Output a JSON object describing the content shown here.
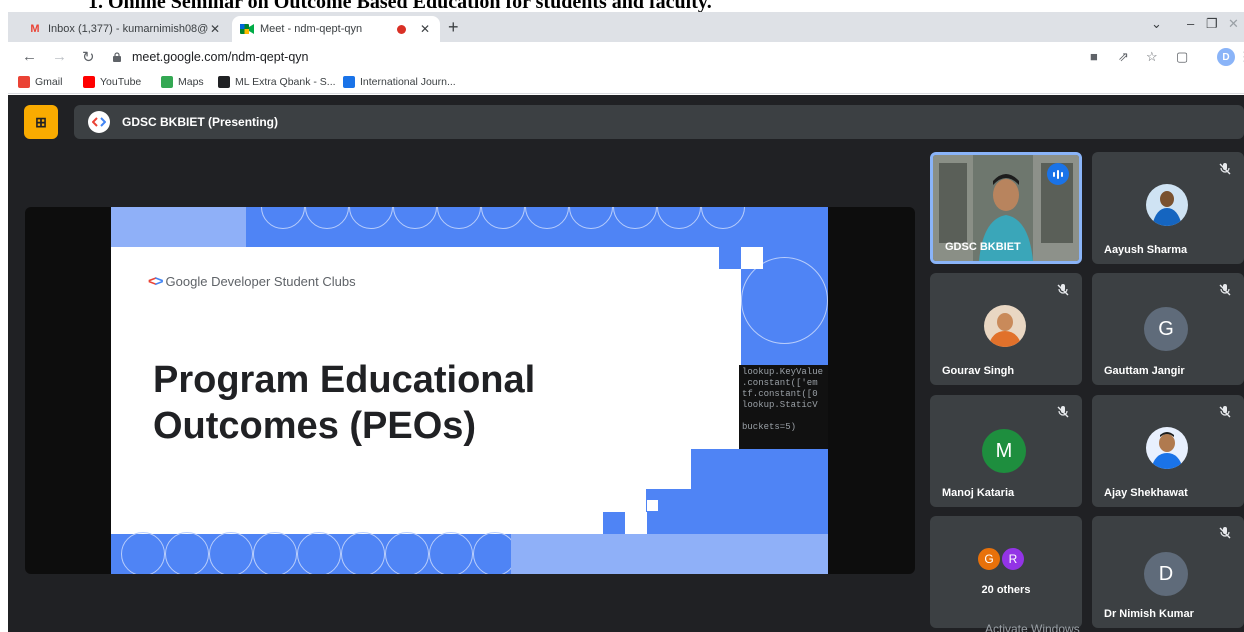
{
  "caption": "1.   Online Seminar on Outcome Based Education for students and faculty.",
  "browser": {
    "tabs": [
      {
        "title": "Inbox (1,377) - kumarnimish08@",
        "icon": "gmail-icon"
      },
      {
        "title": "Meet - ndm-qept-qyn",
        "icon": "meet-icon"
      }
    ],
    "url": "meet.google.com/ndm-qept-qyn",
    "profile_initial": "D",
    "bookmarks": [
      {
        "label": "Gmail",
        "color": "#ea4335"
      },
      {
        "label": "YouTube",
        "color": "#ff0000"
      },
      {
        "label": "Maps",
        "color": "#34a853"
      },
      {
        "label": "ML Extra Qbank - S...",
        "color": "#202124"
      },
      {
        "label": "International Journ...",
        "color": "#1a73e8"
      }
    ]
  },
  "meet": {
    "presenting_label": "GDSC BKBIET (Presenting)",
    "slide": {
      "brand": "Google Developer Student Clubs",
      "title_line1": "Program Educational",
      "title_line2": "Outcomes (PEOs)",
      "code_lines": "lookup.KeyValue\n.constant(['em\ntf.constant([0\nlookup.StaticV\n\nbuckets=5)"
    },
    "participants": [
      {
        "name": "GDSC BKBIET",
        "speaking": true
      },
      {
        "name": "Aayush Sharma",
        "muted": true
      },
      {
        "name": "Gourav Singh",
        "muted": true
      },
      {
        "name": "Gauttam Jangir",
        "initial": "G",
        "color": "#5f6b7a",
        "muted": true
      },
      {
        "name": "Manoj Kataria",
        "initial": "M",
        "color": "#1e8e3e",
        "muted": true
      },
      {
        "name": "Ajay Shekhawat",
        "muted": true
      },
      {
        "name": "20 others",
        "initials": [
          "G",
          "R"
        ],
        "colors": [
          "#e8710a",
          "#9334e6"
        ]
      },
      {
        "name": "Dr Nimish Kumar",
        "initial": "D",
        "color": "#5f6b7a",
        "muted": true
      }
    ]
  },
  "watermark": "Activate Windows"
}
